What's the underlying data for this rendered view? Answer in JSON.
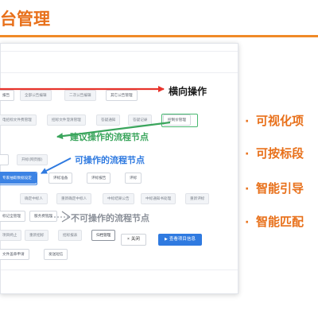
{
  "header": {
    "title": "台管理"
  },
  "workflow_panel": {
    "rows": [
      [
        {
          "label": "报告"
        },
        {
          "label": "全部公告编辑"
        },
        {
          "label": "二次公告编辑"
        },
        {
          "label": "其它公告管理"
        }
      ],
      [
        {
          "label": "电招标文件费管理"
        },
        {
          "label": "招标文件澄清管理"
        },
        {
          "label": "答疑通知"
        },
        {
          "label": "答疑记录"
        },
        {
          "label": "控制价管理"
        }
      ],
      [
        {
          "label": ""
        },
        {
          "label": "开标(网页版)"
        }
      ],
      [
        {
          "label": "专家抽取数据设定"
        },
        {
          "label": "评标准备"
        },
        {
          "label": "评标报告"
        },
        {
          "label": "评标"
        }
      ],
      [
        {
          "label": "确定中标人"
        },
        {
          "label": "重新确定中标人"
        },
        {
          "label": "中标结果公告"
        },
        {
          "label": "中标通知书处理"
        },
        {
          "label": "重新评标"
        }
      ],
      [
        {
          "label": "标记全管理"
        },
        {
          "label": "服务费管理"
        }
      ],
      [
        {
          "label": "项目终止"
        },
        {
          "label": "重新招标"
        },
        {
          "label": "招标报表"
        },
        {
          "label": "归档管理"
        }
      ],
      [
        {
          "label": "文件盖章申请"
        },
        {
          "label": "发送短信"
        }
      ]
    ],
    "close_button": {
      "icon": "×",
      "label": "关闭"
    },
    "view_button": {
      "icon": "▶",
      "label": "查看项目信息"
    }
  },
  "annotations": {
    "horizontal_operation": "横向操作",
    "suggested_node": "建议操作的流程节点",
    "operable_node": "可操作的流程节点",
    "inoperable_node": "不可操作的流程节点"
  },
  "features": [
    {
      "bullet": "·",
      "label": "可视化项"
    },
    {
      "bullet": "·",
      "label": "可按标段"
    },
    {
      "bullet": "·",
      "label": "智能引导"
    },
    {
      "bullet": "·",
      "label": "智能匹配"
    }
  ],
  "colors": {
    "title_orange": "#e8701a",
    "suggested_green": "#3aa55c",
    "operable_blue": "#2f7ae0",
    "arrow_red": "#e8342c",
    "inoperable_gray": "#8a8f98"
  }
}
